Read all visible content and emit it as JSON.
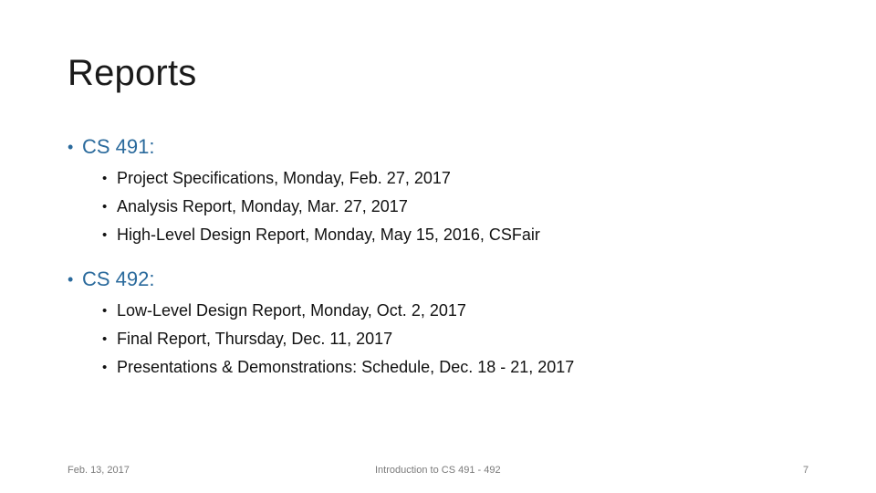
{
  "slide": {
    "title": "Reports",
    "accent_color": "#2a6a9c",
    "bullet_glyph": "•",
    "sections": [
      {
        "heading": "CS 491:",
        "items": [
          "Project Specifications, Monday, Feb. 27, 2017",
          "Analysis Report, Monday, Mar. 27, 2017",
          "High-Level Design Report, Monday, May 15, 2016, CSFair"
        ]
      },
      {
        "heading": "CS 492:",
        "items": [
          "Low-Level Design Report, Monday, Oct. 2, 2017",
          "Final Report, Thursday, Dec. 11, 2017",
          "Presentations & Demonstrations: Schedule, Dec. 18 - 21, 2017"
        ]
      }
    ]
  },
  "footer": {
    "date": "Feb. 13, 2017",
    "center": "Introduction to CS 491 - 492",
    "page_number": "7"
  }
}
